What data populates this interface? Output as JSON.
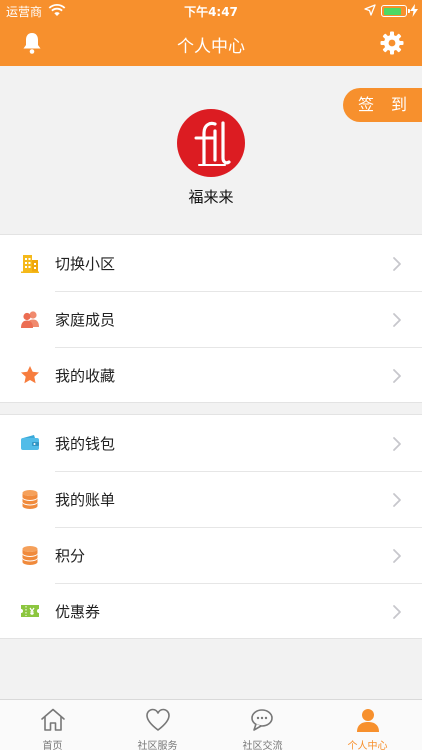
{
  "status_bar": {
    "carrier": "运营商",
    "time": "下午4:47",
    "battery_level": 0.85
  },
  "nav": {
    "title": "个人中心"
  },
  "profile": {
    "checkin_label": "签 到",
    "username": "福来来"
  },
  "menu_groups": [
    [
      {
        "label": "切换小区",
        "icon": "building-icon"
      },
      {
        "label": "家庭成员",
        "icon": "family-members-icon"
      },
      {
        "label": "我的收藏",
        "icon": "star-icon"
      }
    ],
    [
      {
        "label": "我的钱包",
        "icon": "wallet-icon"
      },
      {
        "label": "我的账单",
        "icon": "coins-stack-icon"
      },
      {
        "label": "积分",
        "icon": "coins-stack-icon"
      },
      {
        "label": "优惠券",
        "icon": "coupon-ticket-icon"
      }
    ]
  ],
  "tabbar": {
    "tabs": [
      {
        "label": "首页",
        "icon": "home-icon",
        "active": false
      },
      {
        "label": "社区服务",
        "icon": "heart-icon",
        "active": false
      },
      {
        "label": "社区交流",
        "icon": "chat-bubbles-icon",
        "active": false
      },
      {
        "label": "个人中心",
        "icon": "person-icon",
        "active": true
      }
    ]
  },
  "colors": {
    "accent": "#f7902d",
    "avatar_bg": "#dc1c22",
    "battery": "#4cd964",
    "page_bg": "#f2f2f2"
  }
}
